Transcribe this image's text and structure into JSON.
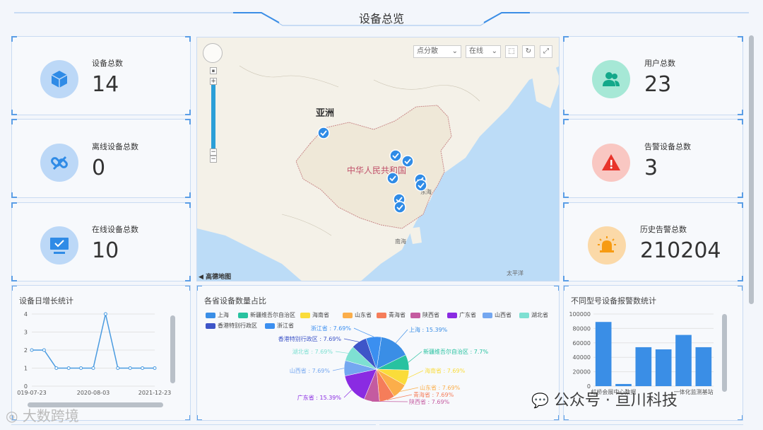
{
  "header": {
    "title": "设备总览"
  },
  "stats": {
    "device_total": {
      "label": "设备总数",
      "value": "14"
    },
    "offline_total": {
      "label": "离线设备总数",
      "value": "0"
    },
    "online_total": {
      "label": "在线设备总数",
      "value": "10"
    },
    "user_total": {
      "label": "用户总数",
      "value": "23"
    },
    "alarm_devices": {
      "label": "告警设备总数",
      "value": "3"
    },
    "history_alarms": {
      "label": "历史告警总数",
      "value": "210204"
    }
  },
  "map": {
    "mode_select": "点分散",
    "status_select": "在线",
    "label_asia": "亚洲",
    "label_china": "中华人民共和国",
    "label_south_sea": "南海",
    "label_pacific": "太平洋",
    "label_east_sea": "东海",
    "attribution": "高德地图",
    "colors": {
      "water": "#bcdcf7",
      "land": "#f4f1e8",
      "marker": "#2f8be6"
    }
  },
  "daily_chart": {
    "title": "设备日增长统计",
    "chart_data": {
      "type": "line",
      "x": [
        "2019-07-23",
        "",
        "",
        "",
        "",
        "2020-08-03",
        "",
        "",
        "",
        "",
        "2021-12-23"
      ],
      "x_tick_labels": [
        "019-07-23",
        "2020-08-03",
        "2021-12-23"
      ],
      "values": [
        2,
        2,
        1,
        1,
        1,
        1,
        4,
        1,
        1,
        1,
        1
      ],
      "ylim": [
        0,
        4
      ],
      "y_ticks": [
        "0",
        "1",
        "2",
        "3",
        "4"
      ],
      "color": "#4a9be0"
    }
  },
  "pie_chart": {
    "title": "各省设备数量占比",
    "chart_data": {
      "type": "pie",
      "legend": [
        "上海",
        "新疆维吾尔自治区",
        "海南省",
        "山东省",
        "青海省",
        "陕西省",
        "广东省",
        "山西省",
        "湖北省",
        "香港特别行政区",
        "浙江省"
      ],
      "labels": [
        "上海 : 15.39%",
        "新疆维吾尔自治区 : 7.7%",
        "海南省 : 7.69%",
        "山东省 : 7.69%",
        "青海省 : 7.69%",
        "陕西省 : 7.69%",
        "广东省 : 15.39%",
        "山西省 : 7.69%",
        "湖北省 : 7.69%",
        "香港特别行政区 : 7.69%",
        "浙江省 : 7.69%"
      ],
      "values": [
        15.39,
        7.7,
        7.69,
        7.69,
        7.69,
        7.69,
        15.39,
        7.69,
        7.69,
        7.69,
        7.69
      ],
      "colors": [
        "#3a8ee6",
        "#28c2a0",
        "#fadc3a",
        "#fbae4a",
        "#f57d5a",
        "#c45ba0",
        "#8a2be2",
        "#74a7f0",
        "#7ee0d2",
        "#3e55c8",
        "#3b8ff0"
      ]
    }
  },
  "bar_chart": {
    "title": "不同型号设备报警数统计",
    "chart_data": {
      "type": "bar",
      "values": [
        89000,
        3000,
        54000,
        51000,
        71000,
        54000
      ],
      "ylim": [
        0,
        100000
      ],
      "y_ticks": [
        "0",
        "20000",
        "40000",
        "60000",
        "80000",
        "100000"
      ],
      "x_tick_labels": [
        "虹桥会展中心数据",
        "一体化监测基站"
      ],
      "color": "#3a8ee6"
    }
  },
  "watermarks": {
    "left": "大数跨境",
    "right": "公众号 · 亘川科技"
  }
}
